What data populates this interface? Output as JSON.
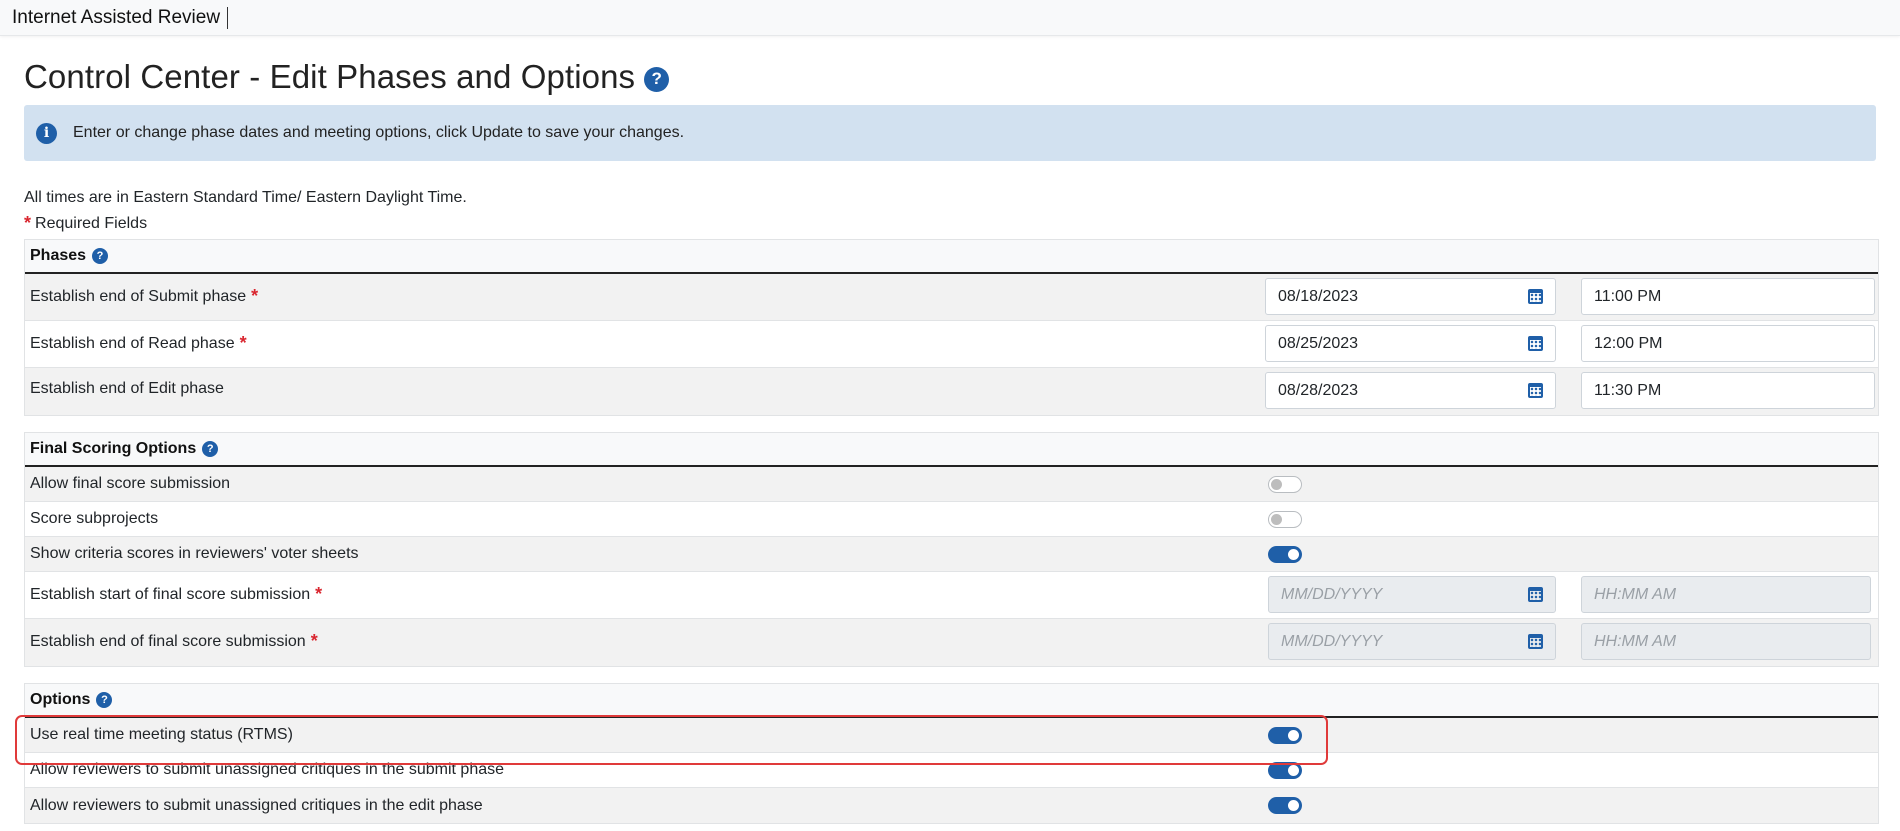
{
  "app": {
    "title": "Internet Assisted Review"
  },
  "page": {
    "title": "Control Center - Edit Phases and Options",
    "help_icon": "question-circle-icon",
    "alert_text": "Enter or change phase dates and meeting options, click Update to save your changes.",
    "alert_icon": "info-circle-icon",
    "timezone_note": "All times are in Eastern Standard Time/ Eastern Daylight Time.",
    "required_note": "Required Fields",
    "required_mark": "*"
  },
  "phases": {
    "header": "Phases",
    "rows": [
      {
        "label": "Establish end of Submit phase",
        "required": true,
        "date": "08/18/2023",
        "time": "11:00 PM"
      },
      {
        "label": "Establish end of Read phase",
        "required": true,
        "date": "08/25/2023",
        "time": "12:00 PM"
      },
      {
        "label": "Establish end of Edit phase",
        "required": false,
        "date": "08/28/2023",
        "time": "11:30 PM"
      }
    ]
  },
  "final_scoring": {
    "header": "Final Scoring Options",
    "toggles": [
      {
        "label": "Allow final score submission",
        "on": false
      },
      {
        "label": "Score subprojects",
        "on": false
      },
      {
        "label": "Show criteria scores in reviewers' voter sheets",
        "on": true
      }
    ],
    "date_rows": [
      {
        "label": "Establish start of final score submission",
        "required": true,
        "date_placeholder": "MM/DD/YYYY",
        "time_placeholder": "HH:MM AM"
      },
      {
        "label": "Establish end of final score submission",
        "required": true,
        "date_placeholder": "MM/DD/YYYY",
        "time_placeholder": "HH:MM AM"
      }
    ]
  },
  "options": {
    "header": "Options",
    "toggles": [
      {
        "label": "Use real time meeting status (RTMS)",
        "on": true,
        "highlighted": true
      },
      {
        "label": "Allow reviewers to submit unassigned critiques in the submit phase",
        "on": true
      },
      {
        "label": "Allow reviewers to submit unassigned critiques in the edit phase",
        "on": true
      }
    ]
  },
  "colors": {
    "accent": "#1f5fa8",
    "required": "#d9262f",
    "alert_bg": "#d2e1f0",
    "highlight": "#e03a3a"
  }
}
